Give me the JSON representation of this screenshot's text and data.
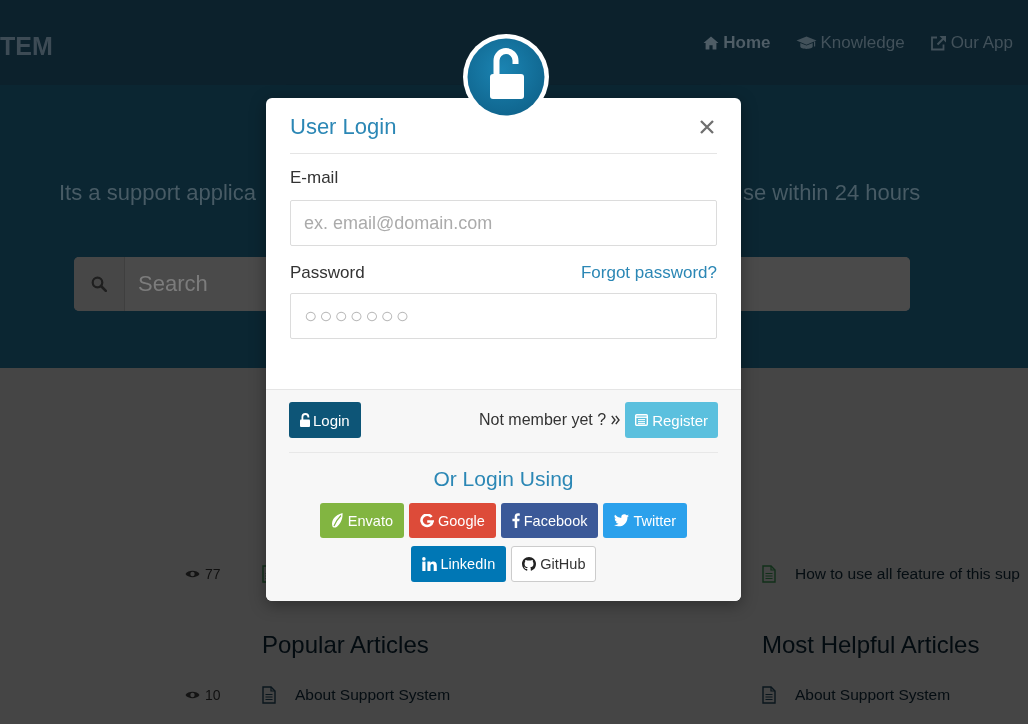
{
  "navbar": {
    "logo": "TEM",
    "links": [
      {
        "label": "Home",
        "kind": "home",
        "selected": true
      },
      {
        "label": "Knowledge",
        "kind": "knowledge",
        "selected": false
      },
      {
        "label": "Our App",
        "kind": "external",
        "selected": false
      }
    ]
  },
  "hero": {
    "tagline_left_visible": "Its a support applica",
    "tagline_right_visible": "se within 24 hours",
    "search": {
      "placeholder": "Search"
    }
  },
  "article_columns": [
    {
      "upper_items": [
        {
          "views": "77"
        }
      ],
      "heading": "Popular Articles",
      "items": [
        {
          "views": "10",
          "title": "About Support System"
        }
      ]
    },
    {
      "upper_items": [
        {
          "title": "How to use all feature of this sup"
        }
      ],
      "heading": "Most Helpful Articles",
      "items": [
        {
          "title": "About Support System"
        }
      ]
    }
  ],
  "login_modal": {
    "title": "User Login",
    "email": {
      "label": "E-mail",
      "placeholder": "ex. email@domain.com"
    },
    "password": {
      "label": "Password",
      "placeholder": "○○○○○○○",
      "link": "Forgot password?"
    },
    "login_button": "Login",
    "register_prompt": "Not member yet ?",
    "register_button": "Register",
    "alt_login_heading": "Or Login Using",
    "social_buttons": [
      {
        "label": "Envato",
        "kind": "envato"
      },
      {
        "label": "Google",
        "kind": "google"
      },
      {
        "label": "Facebook",
        "kind": "facebook"
      },
      {
        "label": "Twitter",
        "kind": "twitter"
      },
      {
        "label": "LinkedIn",
        "kind": "linkedin"
      },
      {
        "label": "GitHub",
        "kind": "github"
      }
    ]
  }
}
